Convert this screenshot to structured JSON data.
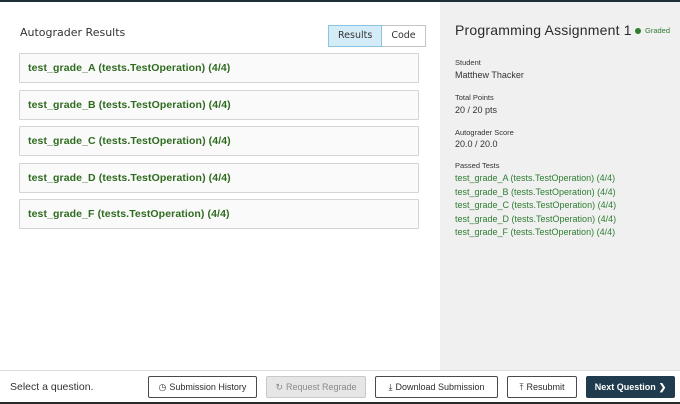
{
  "main": {
    "title": "Autograder Results",
    "tabs": [
      {
        "label": "Results",
        "active": true
      },
      {
        "label": "Code",
        "active": false
      }
    ],
    "tests": [
      "test_grade_A (tests.TestOperation) (4/4)",
      "test_grade_B (tests.TestOperation) (4/4)",
      "test_grade_C (tests.TestOperation) (4/4)",
      "test_grade_D (tests.TestOperation) (4/4)",
      "test_grade_F (tests.TestOperation) (4/4)"
    ]
  },
  "sidebar": {
    "title": "Programming Assignment 1",
    "status": "Graded",
    "student_label": "Student",
    "student_value": "Matthew Thacker",
    "points_label": "Total Points",
    "points_value": "20 / 20 pts",
    "score_label": "Autograder Score",
    "score_value": "20.0 / 20.0",
    "passed_label": "Passed Tests",
    "passed_tests": [
      "test_grade_A (tests.TestOperation) (4/4)",
      "test_grade_B (tests.TestOperation) (4/4)",
      "test_grade_C (tests.TestOperation) (4/4)",
      "test_grade_D (tests.TestOperation) (4/4)",
      "test_grade_F (tests.TestOperation) (4/4)"
    ]
  },
  "footer": {
    "prompt": "Select a question.",
    "submission_history": "Submission History",
    "request_regrade": "Request Regrade",
    "download_submission": "Download Submission",
    "resubmit": "Resubmit",
    "next_question": "Next Question"
  },
  "colors": {
    "accent_green": "#2e7d32",
    "primary_button": "#1f3b4d",
    "active_tab": "#d4ecf8"
  },
  "icons": {
    "history": "clock-icon",
    "regrade": "refresh-icon",
    "download": "download-icon",
    "resubmit": "upload-icon",
    "next": "chevron-right-icon",
    "status": "status-dot-icon"
  }
}
